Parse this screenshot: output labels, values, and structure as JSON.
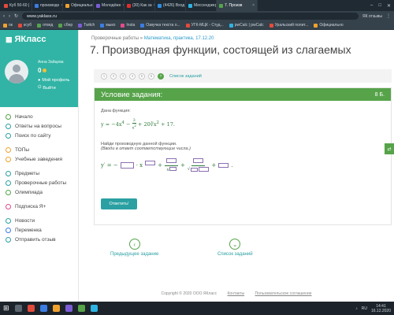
{
  "browser": {
    "tabs": [
      {
        "label": "Куб 50-60 |",
        "color": "#e24b3b"
      },
      {
        "label": "производн",
        "color": "#3b7de2"
      },
      {
        "label": "Официальн",
        "color": "#f0a22e"
      },
      {
        "label": "Молодёжн",
        "color": "#7c5cd6"
      },
      {
        "label": "(30) Как за",
        "color": "#e22d2d"
      },
      {
        "label": "(4426) Вход",
        "color": "#2d8ee2"
      },
      {
        "label": "Мессенджер",
        "color": "#2db3e2"
      },
      {
        "label": "7. Произв",
        "color": "#56a34a",
        "active": true
      }
    ],
    "active_tab_title": "7. Производная функции, состоящей из слагаемых",
    "url": "www.yaklass.ru",
    "sub_tab": "ЯК отзывы",
    "bookmarks": [
      {
        "label": "ок",
        "color": "#f0a22e"
      },
      {
        "label": "ксуб",
        "color": "#e24b3b"
      },
      {
        "label": "отвед",
        "color": "#56a34a"
      },
      {
        "label": "сбер",
        "color": "#56a34a"
      },
      {
        "label": "Twitch",
        "color": "#7c5cd6"
      },
      {
        "label": "мыко",
        "color": "#3b7de2"
      },
      {
        "label": "Insta",
        "color": "#e24b8a"
      },
      {
        "label": "Озвучка текста о...",
        "color": "#3b7de2"
      },
      {
        "label": "УГК-МЦК - Студ...",
        "color": "#e24b3b"
      },
      {
        "label": "pwCalc | pwCalc",
        "color": "#2db3e2"
      },
      {
        "label": "Уральский полит...",
        "color": "#e24b3b"
      },
      {
        "label": "Официально",
        "color": "#f0a22e"
      }
    ]
  },
  "sidebar": {
    "logo": "ЯКласс",
    "user_name": "Анна Зайцева",
    "points": "0",
    "profile_label": "Мой профиль",
    "logout_label": "Выйти",
    "menu_groups": [
      [
        {
          "label": "Начало",
          "color": "#56a34a"
        },
        {
          "label": "Ответы на вопросы",
          "color": "#2ba0a2"
        },
        {
          "label": "Поиск по сайту",
          "color": "#2ba0a2"
        }
      ],
      [
        {
          "label": "ТОПы",
          "color": "#f0a22e"
        },
        {
          "label": "Учебные заведения",
          "color": "#f0a22e"
        }
      ],
      [
        {
          "label": "Предметы",
          "color": "#2ba0a2"
        },
        {
          "label": "Проверочные работы",
          "color": "#2ba0a2"
        },
        {
          "label": "Олимпиада",
          "color": "#56a34a"
        }
      ],
      [
        {
          "label": "Подписка Я+",
          "color": "#e24b8a"
        }
      ],
      [
        {
          "label": "Новости",
          "color": "#2ba0a2"
        },
        {
          "label": "Переменка",
          "color": "#3b7de2"
        },
        {
          "label": "Отправить отзыв",
          "color": "#2ba0a2"
        }
      ]
    ]
  },
  "main": {
    "breadcrumb_section": "Проверочные работы",
    "breadcrumb_sep": "»",
    "breadcrumb_item": "Математика, практика, 17.12.20",
    "title": "7. Производная функции, состоящей из слагаемых",
    "pager": {
      "pages": [
        "1",
        "2",
        "3",
        "4",
        "5",
        "6",
        "7"
      ],
      "active": "7",
      "all_label": "Список заданий"
    },
    "card": {
      "header": "Условие задания:",
      "score": "8 Б.",
      "given": "Дана функция:",
      "task": "Найди производную данной функции.",
      "hint": "(Вводи в ответ соответствующие числа.)",
      "answer_label": "Ответить!"
    },
    "nav": {
      "prev": "Предыдущее задание",
      "list": "Список заданий"
    },
    "footer": {
      "copyright": "Copyright © 2020 ООО ЯКласс",
      "contacts": "Контакты",
      "agreement": "Пользовательское соглашение"
    }
  },
  "taskbar": {
    "lang": "RU",
    "time": "14:41",
    "date": "16.12.2020"
  }
}
